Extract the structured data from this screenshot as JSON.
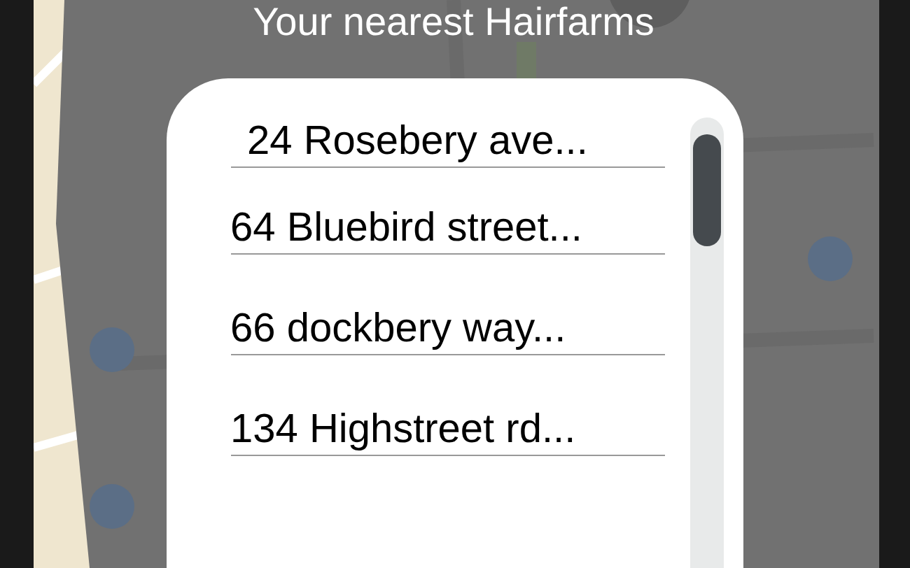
{
  "title": "Your nearest Hairfarms",
  "locations": [
    {
      "address": "24 Rosebery ave..."
    },
    {
      "address": "64 Bluebird street..."
    },
    {
      "address": "66 dockbery way..."
    },
    {
      "address": "134 Highstreet rd..."
    }
  ]
}
